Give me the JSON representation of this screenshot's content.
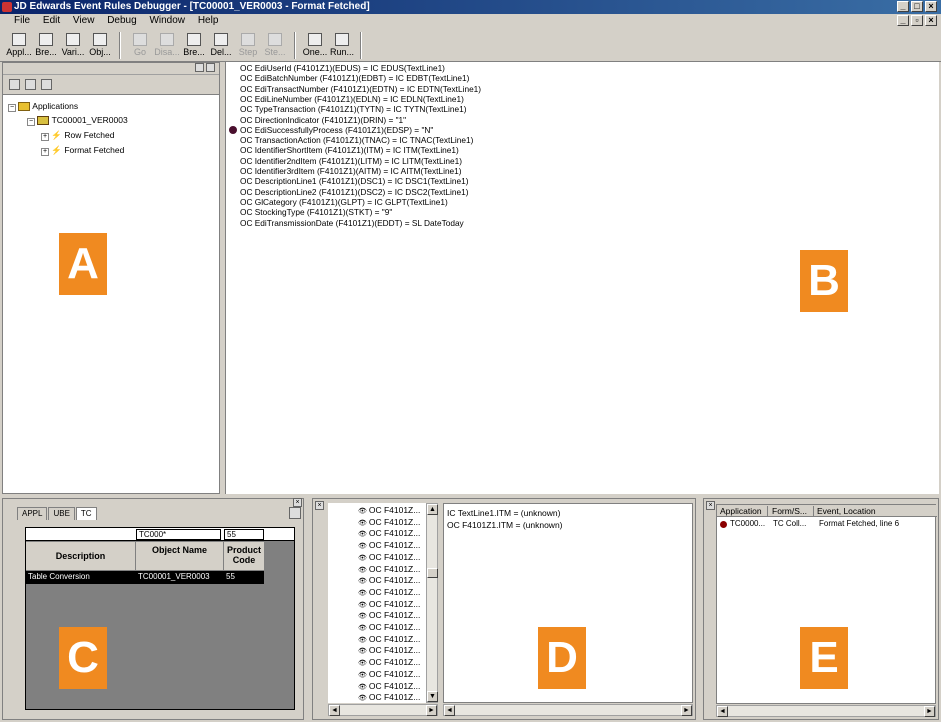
{
  "window": {
    "title": "JD Edwards Event Rules Debugger - [TC00001_VER0003 - Format Fetched]"
  },
  "menu": [
    "File",
    "Edit",
    "View",
    "Debug",
    "Window",
    "Help"
  ],
  "toolbar": {
    "buttons": [
      {
        "label": "Appl...",
        "enabled": true
      },
      {
        "label": "Bre...",
        "enabled": true
      },
      {
        "label": "Vari...",
        "enabled": true
      },
      {
        "label": "Obj...",
        "enabled": true
      },
      {
        "label": "Go",
        "enabled": false
      },
      {
        "label": "Disa...",
        "enabled": false
      },
      {
        "label": "Bre...",
        "enabled": true
      },
      {
        "label": "Del...",
        "enabled": true
      },
      {
        "label": "Step",
        "enabled": false
      },
      {
        "label": "Ste...",
        "enabled": false
      },
      {
        "label": "One...",
        "enabled": true
      },
      {
        "label": "Run...",
        "enabled": true
      }
    ]
  },
  "tree": {
    "root": "Applications",
    "child": "TC00001_VER0003",
    "items": [
      "Row Fetched",
      "Format Fetched"
    ]
  },
  "code": {
    "lines": [
      "OC EdiUserId (F4101Z1)(EDUS) = IC EDUS(TextLine1)",
      "OC EdiBatchNumber (F4101Z1)(EDBT) = IC EDBT(TextLine1)",
      "OC EdiTransactNumber (F4101Z1)(EDTN) = IC EDTN(TextLine1)",
      "OC EdiLineNumber (F4101Z1)(EDLN) = IC EDLN(TextLine1)",
      "OC TypeTransaction (F4101Z1)(TYTN) = IC TYTN(TextLine1)",
      "OC DirectionIndicator (F4101Z1)(DRIN) = \"1\"",
      "OC EdiSuccessfullyProcess (F4101Z1)(EDSP) = \"N\"",
      "OC TransactionAction (F4101Z1)(TNAC) = IC TNAC(TextLine1)",
      "OC IdentifierShortItem (F4101Z1)(ITM) = IC ITM(TextLine1)",
      "OC Identifier2ndItem (F4101Z1)(LITM) = IC LITM(TextLine1)",
      "OC Identifier3rdItem (F4101Z1)(AITM) = IC AITM(TextLine1)",
      "OC DescriptionLine1 (F4101Z1)(DSC1) = IC DSC1(TextLine1)",
      "OC DescriptionLine2 (F4101Z1)(DSC2) = IC DSC2(TextLine1)",
      "OC GlCategory (F4101Z1)(GLPT) = IC GLPT(TextLine1)",
      "OC StockingType (F4101Z1)(STKT) = \"9\"",
      "OC EdiTransmissionDate (F4101Z1)(EDDT) = SL DateToday"
    ],
    "breakpoint_line": 6
  },
  "panelC": {
    "tabs": [
      "APPL",
      "UBE",
      "TC"
    ],
    "active_tab": "TC",
    "filter": {
      "object": "TC000*",
      "code": "55"
    },
    "headers": [
      "Description",
      "Object Name",
      "Product Code"
    ],
    "rows": [
      [
        "Table Conversion",
        "TC00001_VER0003",
        "55"
      ]
    ]
  },
  "panelD": {
    "tree_item": "OC F4101Z...",
    "tree_count": 17,
    "values": [
      "IC TextLine1.ITM = (unknown)",
      "OC F4101Z1.ITM = (unknown)"
    ]
  },
  "panelE": {
    "headers": [
      "Application",
      "Form/S...",
      "Event, Location"
    ],
    "rows": [
      [
        "TC0000...",
        "TC Coll...",
        "Format Fetched, line 6"
      ]
    ]
  },
  "labels": {
    "a": "A",
    "b": "B",
    "c": "C",
    "d": "D",
    "e": "E"
  },
  "colors": {
    "title_start": "#0a246a",
    "label_bg": "#f08a20",
    "breakpoint": "#4a0f2e",
    "selected_row": "#000000"
  }
}
